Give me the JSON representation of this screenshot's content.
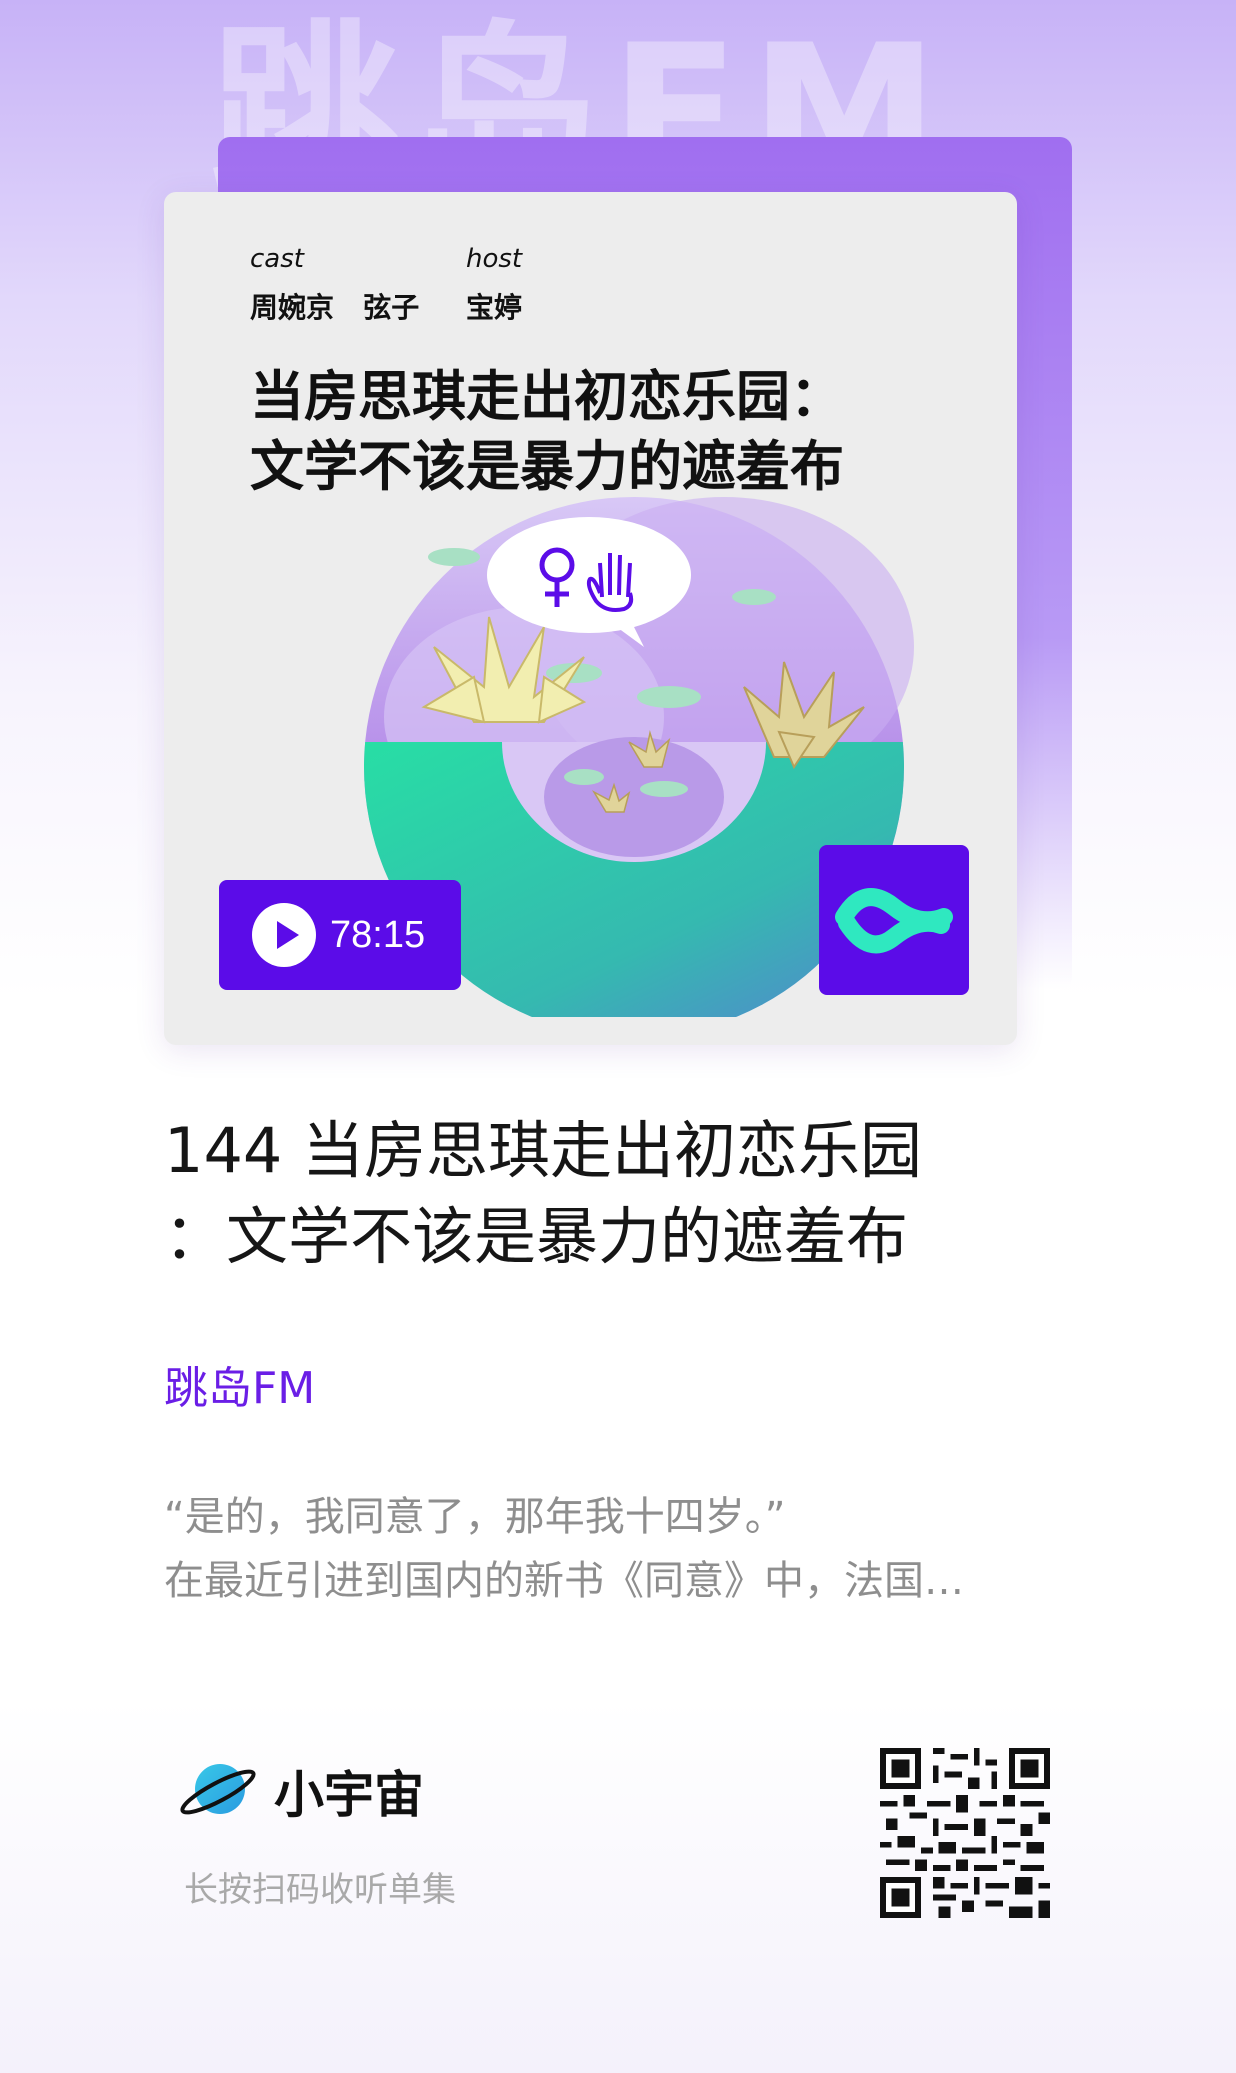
{
  "background_watermark": "跳岛FM",
  "cover": {
    "cast_label": "cast",
    "cast_names": "周婉京   弦子",
    "host_label": "host",
    "host_names": "宝婷",
    "title_line1": "当房思琪走出初恋乐园：",
    "title_line2": "文学不该是暴力的遮羞布",
    "speech_icons": [
      "female-symbol-icon",
      "raised-hand-icon"
    ],
    "duration": "78:15",
    "accent_color": "#5b0ce8"
  },
  "episode": {
    "title_line1": "144 当房思琪走出初恋乐园",
    "title_line2": "：文学不该是暴力的遮羞布"
  },
  "podcast_name": "跳岛FM",
  "description": {
    "line1": "“是的，我同意了，那年我十四岁。”",
    "line2": "在最近引进到国内的新书《同意》中，法国…"
  },
  "footer": {
    "brand_name": "小宇宙",
    "scan_hint": "长按扫码收听单集"
  }
}
